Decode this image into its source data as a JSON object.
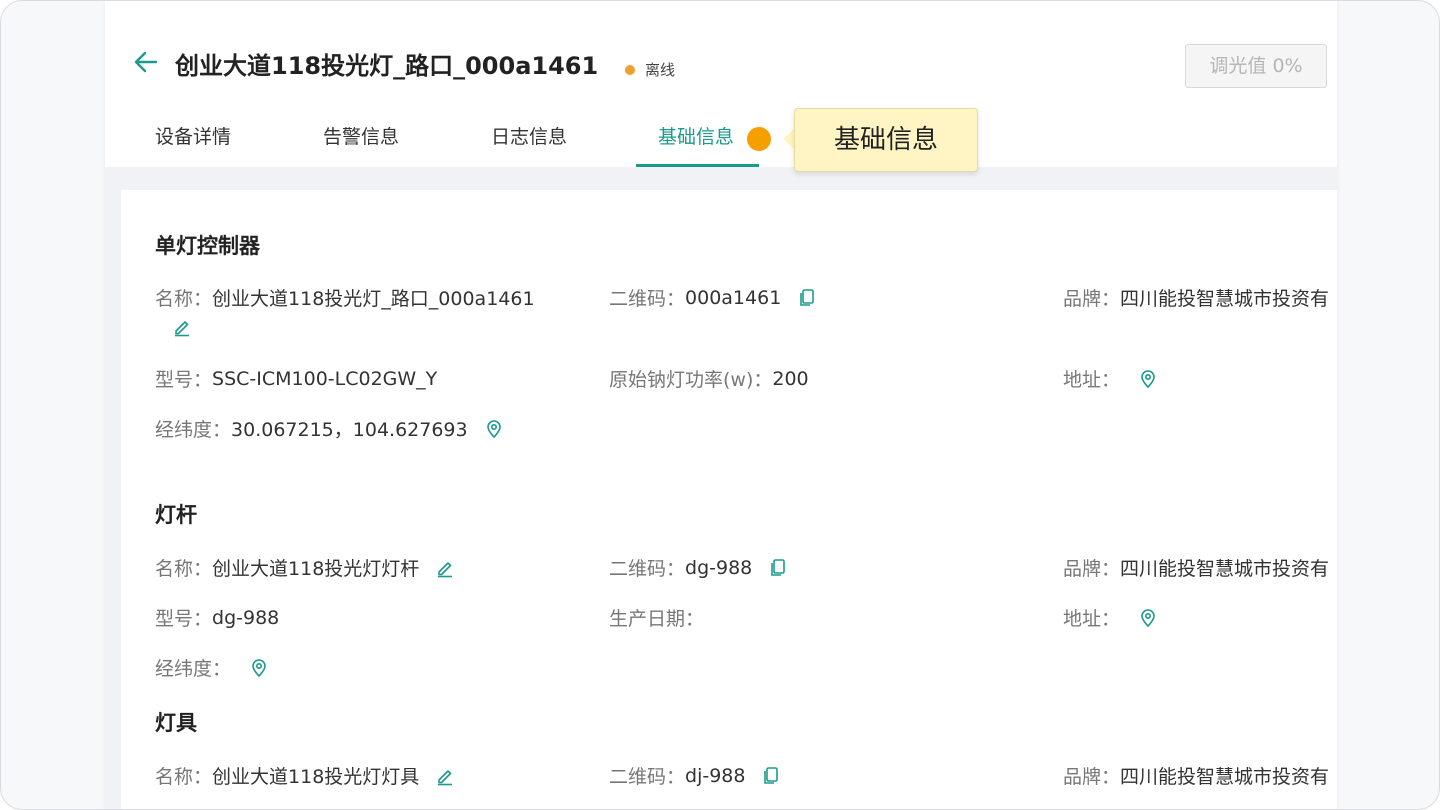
{
  "header": {
    "title": "创业大道118投光灯_路口_000a1461",
    "status": "离线",
    "dim_button": "调光值 0%"
  },
  "tabs": [
    {
      "label": "设备详情"
    },
    {
      "label": "告警信息"
    },
    {
      "label": "日志信息"
    },
    {
      "label": "基础信息",
      "active": true
    }
  ],
  "tooltip": "基础信息",
  "colors": {
    "accent": "#1a9b8c",
    "status_offline": "#f0a030",
    "tooltip_bg": "#fff5c4"
  },
  "sections": {
    "controller": {
      "title": "单灯控制器",
      "name_label": "名称：",
      "name": "创业大道118投光灯_路口_000a1461",
      "qr_label": "二维码：",
      "qr": "000a1461",
      "brand_label": "品牌：",
      "brand": "四川能投智慧城市投资有",
      "model_label": "型号：",
      "model": "SSC-ICM100-LC02GW_Y",
      "power_label": "原始钠灯功率(w)：",
      "power": "200",
      "address_label": "地址：",
      "latlng_label": "经纬度：",
      "latlng": "30.067215，104.627693"
    },
    "pole": {
      "title": "灯杆",
      "name_label": "名称：",
      "name": "创业大道118投光灯灯杆",
      "qr_label": "二维码：",
      "qr": "dg-988",
      "brand_label": "品牌：",
      "brand": "四川能投智慧城市投资有",
      "model_label": "型号：",
      "model": "dg-988",
      "date_label": "生产日期：",
      "address_label": "地址：",
      "latlng_label": "经纬度："
    },
    "lamp": {
      "title": "灯具",
      "name_label": "名称：",
      "name": "创业大道118投光灯灯具",
      "qr_label": "二维码：",
      "qr": "dj-988",
      "brand_label": "品牌：",
      "brand": "四川能投智慧城市投资有"
    }
  },
  "icons": [
    "back-arrow-icon",
    "edit-icon",
    "copy-icon",
    "location-pin-icon"
  ]
}
